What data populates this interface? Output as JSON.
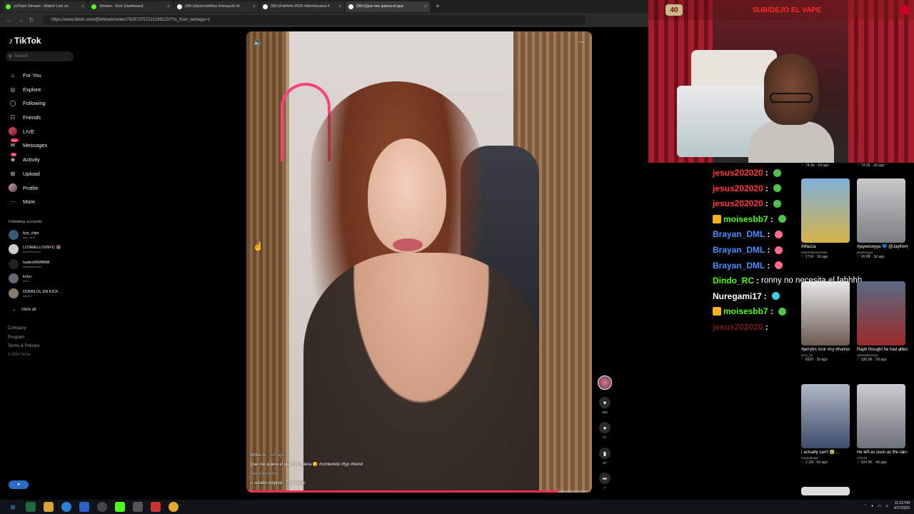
{
  "browser": {
    "tabs": [
      {
        "title": "yoTwizt Stream - Watch Live on",
        "color": "#53fc18"
      },
      {
        "title": "Stream - Kick Dashboard",
        "color": "#53fc18"
      },
      {
        "title": "(99+)#ponchdrillss #newyork #c",
        "color": "#ffffff"
      },
      {
        "title": "(99+)Fahhhh #025 #dominicana #",
        "color": "#ffffff"
      },
      {
        "title": "(99+)Que me quiera el que",
        "color": "#ffffff"
      }
    ],
    "new_tab": "+",
    "url": "https://www.tiktok.com/@ikhloetv/video/7529737572211991237?is_from_webapp=1"
  },
  "sidebar": {
    "logo": "TikTok",
    "search_placeholder": "Search",
    "nav": [
      {
        "label": "For You",
        "icon": "home-icon",
        "glyph": "⌂"
      },
      {
        "label": "Explore",
        "icon": "compass-icon",
        "glyph": "◎"
      },
      {
        "label": "Following",
        "icon": "following-icon",
        "glyph": "◯"
      },
      {
        "label": "Friends",
        "icon": "friends-icon",
        "glyph": "☷"
      },
      {
        "label": "LIVE",
        "icon": "live-icon",
        "glyph": ""
      },
      {
        "label": "Messages",
        "icon": "messages-icon",
        "glyph": "✉",
        "badge": "99+"
      },
      {
        "label": "Activity",
        "icon": "activity-icon",
        "glyph": "◈",
        "badge": "99"
      },
      {
        "label": "Upload",
        "icon": "upload-icon",
        "glyph": "⊞"
      },
      {
        "label": "Profile",
        "icon": "profile-icon",
        "glyph": ""
      },
      {
        "label": "More",
        "icon": "more-icon",
        "glyph": "···"
      }
    ],
    "following_label": "Following accounts",
    "accounts": [
      {
        "name": "tyty_clips",
        "handle": "tyty_clips"
      },
      {
        "name": "LOSMELLOSNYC 🐻",
        "handle": "losmellosnyc2"
      },
      {
        "name": "hades66MMMF",
        "handle": "hades66mmmf"
      },
      {
        "name": "krlou",
        "handle": "krlou"
      },
      {
        "name": "DOMIILOL EN KICK ..",
        "handle": "sgolilol"
      }
    ],
    "view_all": "View all",
    "footer": [
      "Company",
      "Program",
      "Terms & Policies"
    ],
    "copyright": "© 2024 TikTok"
  },
  "video": {
    "username": "ikhloe.tv",
    "time_ago": "11h ago",
    "description": "Que me quiera el que me quiera 😏 #contenido #fyp #trend",
    "see_translation": "See translation",
    "sound": "sonido original - TrapMusic",
    "progress_fraction": 0.9,
    "actions": [
      {
        "name": "like",
        "icon": "heart-icon",
        "glyph": "♥",
        "count": "204"
      },
      {
        "name": "comment",
        "icon": "comment-icon",
        "glyph": "●",
        "count": "17"
      },
      {
        "name": "bookmark",
        "icon": "bookmark-icon",
        "glyph": "▮",
        "count": "67"
      },
      {
        "name": "share",
        "icon": "share-icon",
        "glyph": "➦",
        "count": "7"
      }
    ]
  },
  "webcam": {
    "count": "40",
    "title": "SUB/DEJO EL VAPE"
  },
  "chat": [
    {
      "user": "jesus202020",
      "color": "#ff3b3b",
      "emote_color": "#4fc24a",
      "msg": ""
    },
    {
      "user": "jesus202020",
      "color": "#ff3b3b",
      "emote_color": "#4fc24a",
      "msg": ""
    },
    {
      "user": "jesus202020",
      "color": "#ff3b3b",
      "emote_color": "#4fc24a",
      "msg": ""
    },
    {
      "user": "moisesbb7",
      "color": "#53fc18",
      "emote_color": "#4fc24a",
      "msg": "",
      "badge": true
    },
    {
      "user": "Brayan_DML",
      "color": "#4f8cff",
      "emote_color": "#ff6b8a",
      "msg": ""
    },
    {
      "user": "Brayan_DML",
      "color": "#4f8cff",
      "emote_color": "#ff6b8a",
      "msg": ""
    },
    {
      "user": "Brayan_DML",
      "color": "#4f8cff",
      "emote_color": "#ff6b8a",
      "msg": ""
    },
    {
      "user": "Dindo_RC",
      "color": "#53fc18",
      "emote_color": "",
      "msg": "ronny no necesita el fahhhh"
    },
    {
      "user": "Nuregami17",
      "color": "#ffffff",
      "emote_color": "#3fd0e0",
      "msg": ""
    },
    {
      "user": "moisesbb7",
      "color": "#53fc18",
      "emote_color": "#4fc24a",
      "msg": "",
      "badge": true
    },
    {
      "user": "jesus202020",
      "color": "#7a1a1a",
      "emote_color": "",
      "msg": ""
    }
  ],
  "recs": [
    {
      "title": "#lifacca",
      "user": "stepontheseresale",
      "views": "171K",
      "ago": "3d ago",
      "c1": "#7fb0d8",
      "c2": "#d6b24a"
    },
    {
      "title": "#jaywicwyya 💙 @Jayfmmyc 😂",
      "user": "jaywicwyya",
      "views": "26.8K",
      "ago": "3d ago",
      "c1": "#c8c8c8",
      "c2": "#7c7f84"
    },
    {
      "title": "#jerryhn #cor #ny #humor",
      "user": "jerry_hn",
      "views": "6920",
      "ago": "2d ago",
      "c1": "#e8e8e8",
      "c2": "#6b5a50"
    },
    {
      "title": "Raph thought he had allies in ther...",
      "user": "raphaeleloclips",
      "views": "330.5K",
      "ago": "2d ago",
      "c1": "#5a6a84",
      "c2": "#9a2a2a"
    },
    {
      "title": "I actually can't 😭 ...",
      "user": "rheandtoast",
      "views": "2.1M",
      "ago": "6d ago",
      "c1": "#b0b8c4",
      "c2": "#3d4b6a"
    },
    {
      "title": "He left as soon as the rain stopped...",
      "user": "cris124",
      "views": "524.6K",
      "ago": "4d ago",
      "c1": "#c9ccd0",
      "c2": "#6d7178"
    }
  ],
  "recs_top": {
    "views": "74.3K",
    "ago": "2d ago"
  },
  "taskbar": {
    "time": "11:23 PM",
    "date": "4/17/2025"
  }
}
